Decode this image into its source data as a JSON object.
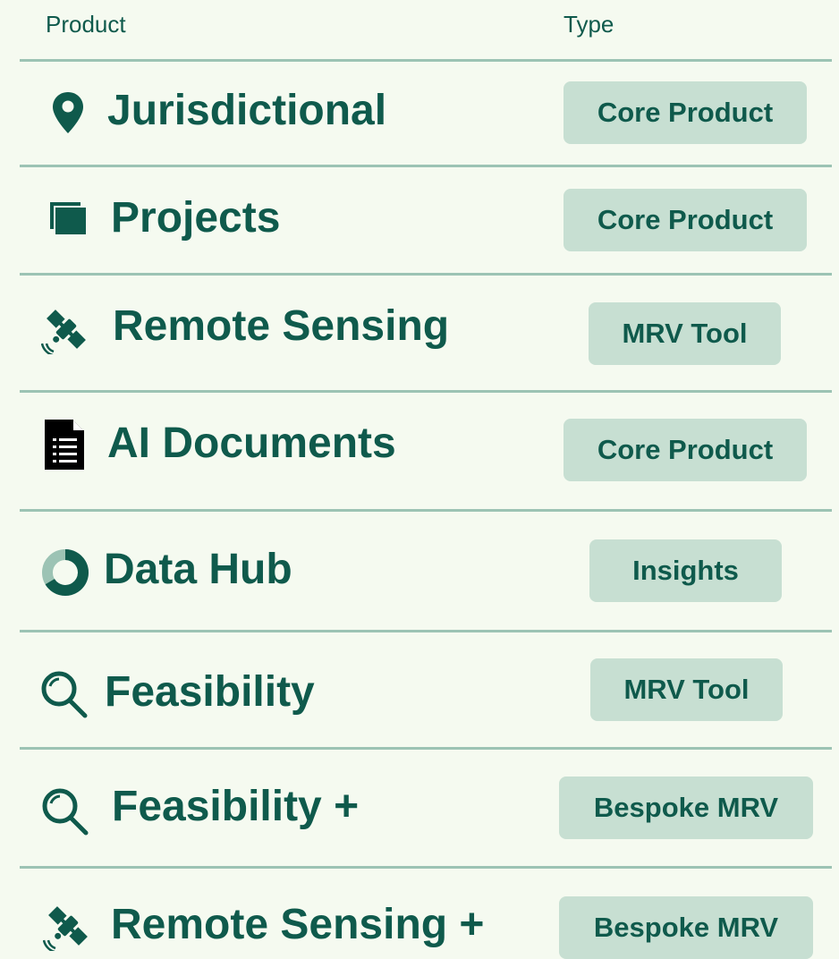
{
  "header": {
    "product_label": "Product",
    "type_label": "Type"
  },
  "colors": {
    "background": "#f5faf0",
    "text": "#0f5a4c",
    "divider": "#9cc3b4",
    "badge_background": "#c7dfd2"
  },
  "rows": [
    {
      "icon": "map-pin-icon",
      "name": "Jurisdictional",
      "type": "Core Product"
    },
    {
      "icon": "folder-icon",
      "name": "Projects",
      "type": "Core Product"
    },
    {
      "icon": "satellite-icon",
      "name": "Remote Sensing",
      "type": "MRV Tool"
    },
    {
      "icon": "document-icon",
      "name": "AI Documents",
      "type": "Core Product"
    },
    {
      "icon": "donut-chart-icon",
      "name": "Data Hub",
      "type": "Insights"
    },
    {
      "icon": "search-icon",
      "name": "Feasibility",
      "type": "MRV Tool"
    },
    {
      "icon": "search-icon",
      "name": "Feasibility +",
      "type": "Bespoke MRV"
    },
    {
      "icon": "satellite-icon",
      "name": "Remote Sensing +",
      "type": "Bespoke MRV"
    }
  ]
}
